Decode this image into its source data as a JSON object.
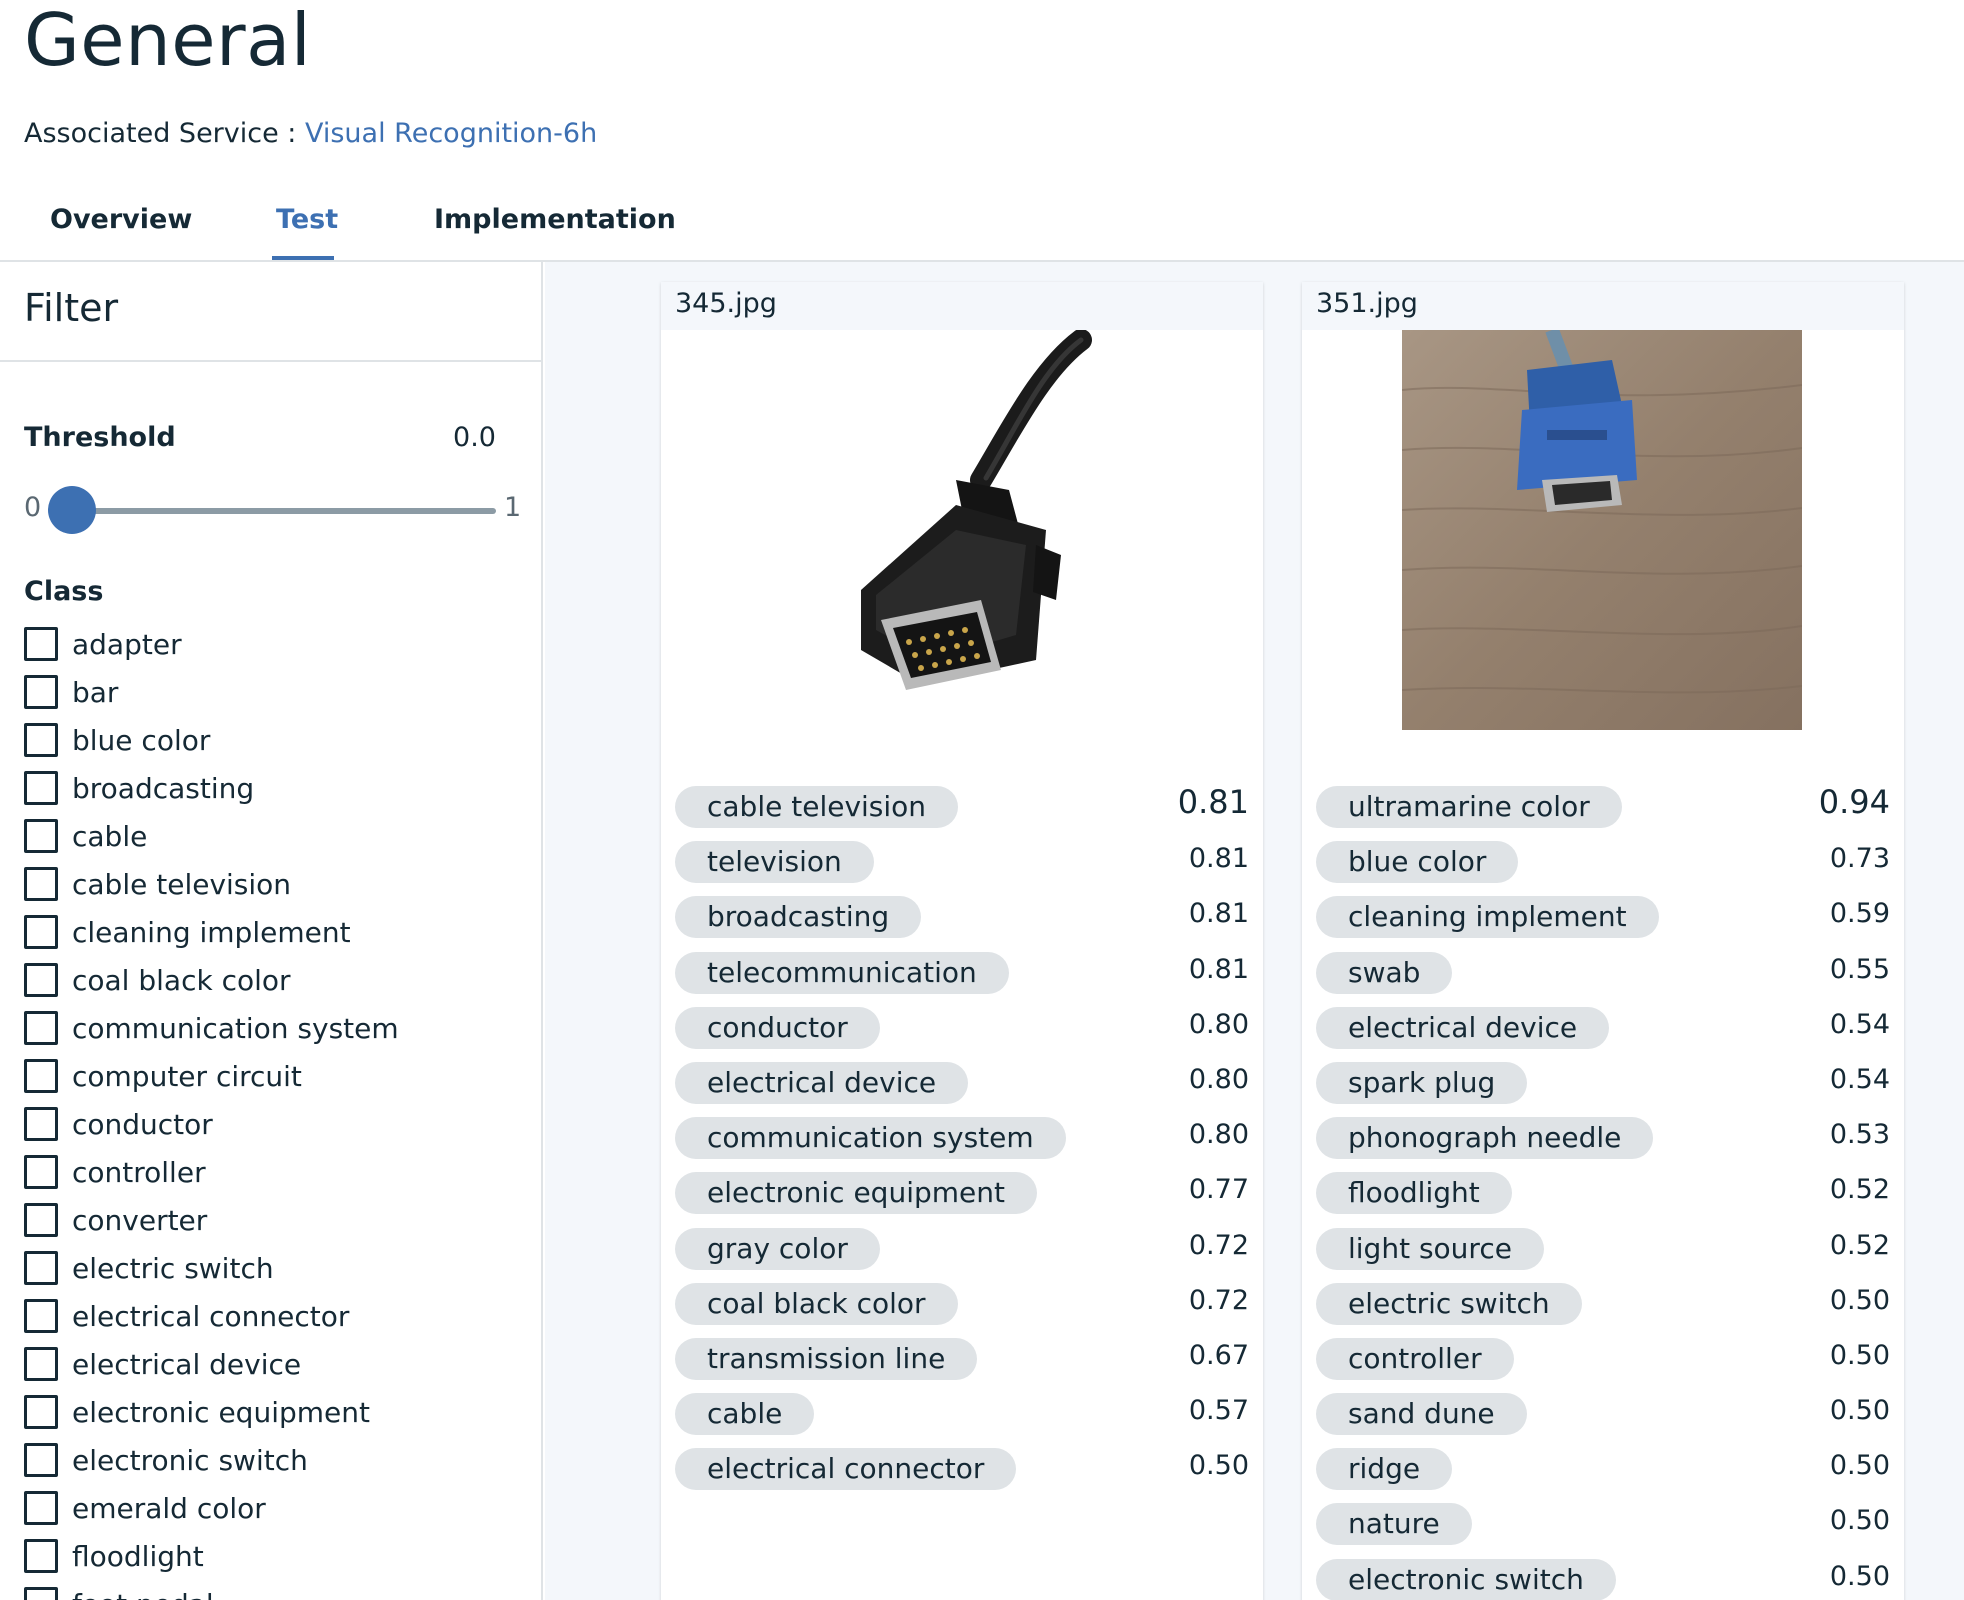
{
  "header": {
    "title": "General",
    "service_label": "Associated Service : ",
    "service_link": "Visual Recognition-6h"
  },
  "tabs": [
    {
      "label": "Overview",
      "active": false
    },
    {
      "label": "Test",
      "active": true
    },
    {
      "label": "Implementation",
      "active": false
    }
  ],
  "sidebar": {
    "filter_title": "Filter",
    "threshold_label": "Threshold",
    "threshold_value": "0.0",
    "slider_min": "0",
    "slider_max": "1",
    "slider_level": 0.0,
    "class_title": "Class",
    "classes": [
      "adapter",
      "bar",
      "blue color",
      "broadcasting",
      "cable",
      "cable television",
      "cleaning implement",
      "coal black color",
      "communication system",
      "computer circuit",
      "conductor",
      "controller",
      "converter",
      "electric switch",
      "electrical connector",
      "electrical device",
      "electronic equipment",
      "electronic switch",
      "emerald color",
      "floodlight",
      "foot pedal"
    ]
  },
  "cards": [
    {
      "filename": "345.jpg",
      "image_icon": "vga-cable-black-photo",
      "results": [
        {
          "label": "cable television",
          "score": "0.81"
        },
        {
          "label": "television",
          "score": "0.81"
        },
        {
          "label": "broadcasting",
          "score": "0.81"
        },
        {
          "label": "telecommunication",
          "score": "0.81"
        },
        {
          "label": "conductor",
          "score": "0.80"
        },
        {
          "label": "electrical device",
          "score": "0.80"
        },
        {
          "label": "communication system",
          "score": "0.80"
        },
        {
          "label": "electronic equipment",
          "score": "0.77"
        },
        {
          "label": "gray color",
          "score": "0.72"
        },
        {
          "label": "coal black color",
          "score": "0.72"
        },
        {
          "label": "transmission line",
          "score": "0.67"
        },
        {
          "label": "cable",
          "score": "0.57"
        },
        {
          "label": "electrical connector",
          "score": "0.50"
        }
      ]
    },
    {
      "filename": "351.jpg",
      "image_icon": "vga-cable-blue-on-wood-photo",
      "results": [
        {
          "label": "ultramarine color",
          "score": "0.94"
        },
        {
          "label": "blue color",
          "score": "0.73"
        },
        {
          "label": "cleaning implement",
          "score": "0.59"
        },
        {
          "label": "swab",
          "score": "0.55"
        },
        {
          "label": "electrical device",
          "score": "0.54"
        },
        {
          "label": "spark plug",
          "score": "0.54"
        },
        {
          "label": "phonograph needle",
          "score": "0.53"
        },
        {
          "label": "floodlight",
          "score": "0.52"
        },
        {
          "label": "light source",
          "score": "0.52"
        },
        {
          "label": "electric switch",
          "score": "0.50"
        },
        {
          "label": "controller",
          "score": "0.50"
        },
        {
          "label": "sand dune",
          "score": "0.50"
        },
        {
          "label": "ridge",
          "score": "0.50"
        },
        {
          "label": "nature",
          "score": "0.50"
        },
        {
          "label": "electronic switch",
          "score": "0.50"
        }
      ]
    }
  ],
  "colors": {
    "accent": "#3d70b2",
    "text": "#152935",
    "tag_bg": "#dfe3e6",
    "panel_bg": "#f4f7fb"
  }
}
